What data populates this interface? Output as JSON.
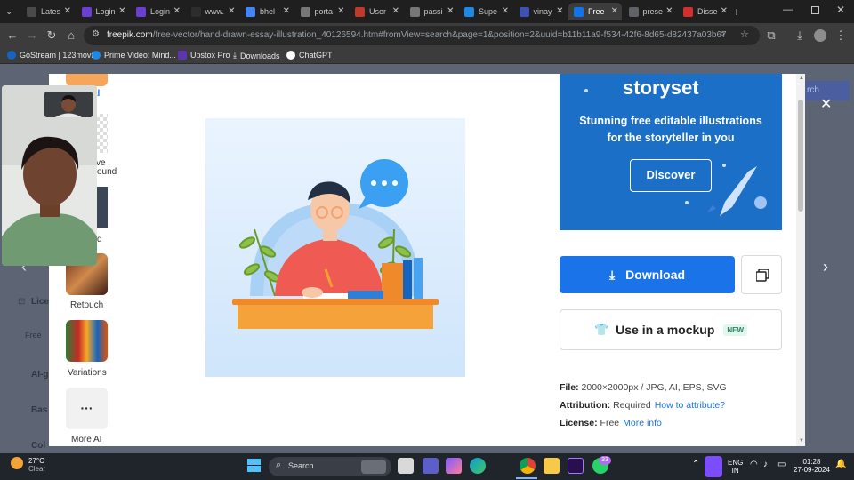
{
  "browser": {
    "tabs": [
      {
        "label": "Lates",
        "color": "#4a4a4a",
        "active": false
      },
      {
        "label": "Login",
        "color": "#6b3fd1",
        "active": false
      },
      {
        "label": "Login",
        "color": "#6b3fd1",
        "active": false
      },
      {
        "label": "www.",
        "color": "#2d2d2d",
        "active": false
      },
      {
        "label": "bhel",
        "color": "#4285f4",
        "active": false
      },
      {
        "label": "porta",
        "color": "#777777",
        "active": false
      },
      {
        "label": "User",
        "color": "#c0392b",
        "active": false
      },
      {
        "label": "passi",
        "color": "#777777",
        "active": false
      },
      {
        "label": "Supe",
        "color": "#1e88e5",
        "active": false
      },
      {
        "label": "vinay",
        "color": "#3f51b5",
        "active": false
      },
      {
        "label": "Free",
        "color": "#1273eb",
        "active": true
      },
      {
        "label": "prese",
        "color": "#5f6368",
        "active": false
      },
      {
        "label": "Disse",
        "color": "#d32f2f",
        "active": false
      }
    ],
    "new_tab": "+",
    "url_host": "freepik.com",
    "url_path": "/free-vector/hand-drawn-essay-illustration_40126594.htm#fromView=search&page=1&position=2&uuid=b11b11a9-f534-42f6-8d65-d82437a03b67",
    "bookmarks": [
      {
        "label": "GoStream | 123movi...",
        "color": "#1565c0"
      },
      {
        "label": "Prime Video: Mind...",
        "color": "#1e88e5"
      },
      {
        "label": "Upstox Pro",
        "color": "#5e35b1"
      },
      {
        "label": "Downloads",
        "color": "#9e9e9e"
      },
      {
        "label": "ChatGPT",
        "color": "#ffffff"
      }
    ]
  },
  "tools": [
    {
      "label": "Retouch"
    },
    {
      "label": "Variations"
    },
    {
      "label": "More AI"
    }
  ],
  "tools_partial": {
    "top": "al",
    "bg1": "ve",
    "bg2": "ound",
    "edit": "d"
  },
  "background_page": {
    "left_items": [
      "Lice",
      "Free",
      "AI-g",
      "Bas",
      "Col"
    ],
    "search_btn": "rch"
  },
  "storyset": {
    "logo": "storyset",
    "tagline_1": "Stunning free editable illustrations",
    "tagline_2": "for the storyteller in you",
    "button": "Discover"
  },
  "actions": {
    "download": "Download",
    "mockup": "Use in a mockup",
    "mockup_badge": "NEW"
  },
  "meta": {
    "file_label": "File:",
    "file_value": "2000×2000px / JPG, AI, EPS, SVG",
    "attribution_label": "Attribution:",
    "attribution_value": "Required",
    "attribution_link": "How to attribute?",
    "license_label": "License:",
    "license_value": "Free",
    "license_link": "More info"
  },
  "taskbar": {
    "weather_temp": "27°C",
    "weather_desc": "Clear",
    "search_placeholder": "Search",
    "whatsapp_badge": "33",
    "lang_1": "ENG",
    "lang_2": "IN",
    "time": "01:28",
    "date": "27-09-2024"
  }
}
